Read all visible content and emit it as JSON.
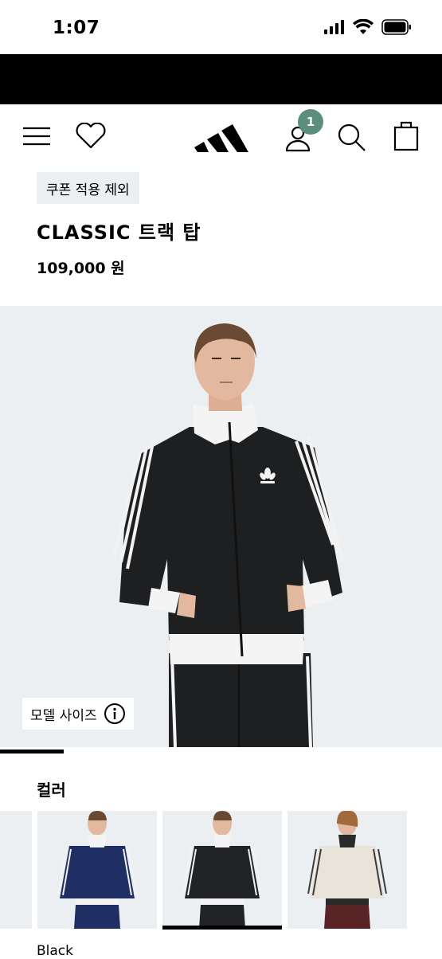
{
  "status_bar": {
    "time": "1:07"
  },
  "nav": {
    "badge_count": "1"
  },
  "product": {
    "tag": "쿠폰 적용 제외",
    "name": "CLASSIC 트랙 탑",
    "price": "109,000 원"
  },
  "hero": {
    "model_size_label": "모델 사이즈",
    "jacket_color": "#1e1f21"
  },
  "colors": {
    "heading": "컬러",
    "selected_name": "Black",
    "swatches": [
      {
        "name": "navy",
        "hex": "#1f2f63"
      },
      {
        "name": "black",
        "hex": "#222326"
      },
      {
        "name": "cream",
        "hex": "#e9e4da"
      }
    ]
  }
}
